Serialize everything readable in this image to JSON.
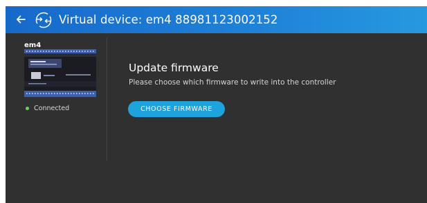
{
  "header": {
    "title": "Virtual device: em4 88981123002152",
    "back_icon": "arrow-left-icon",
    "device_icon": "sync-device-icon",
    "colors": {
      "gradient_start": "#1769c9",
      "gradient_end": "#2799e0"
    }
  },
  "sidebar": {
    "device_name": "em4",
    "status_label": "Connected",
    "status_color": "#6fd24d"
  },
  "main": {
    "title": "Update firmware",
    "subtitle": "Please choose which firmware to write into the controller",
    "choose_button_label": "CHOOSE FIRMWARE",
    "button_color": "#1ea3dc"
  },
  "colors": {
    "background": "#303030"
  }
}
